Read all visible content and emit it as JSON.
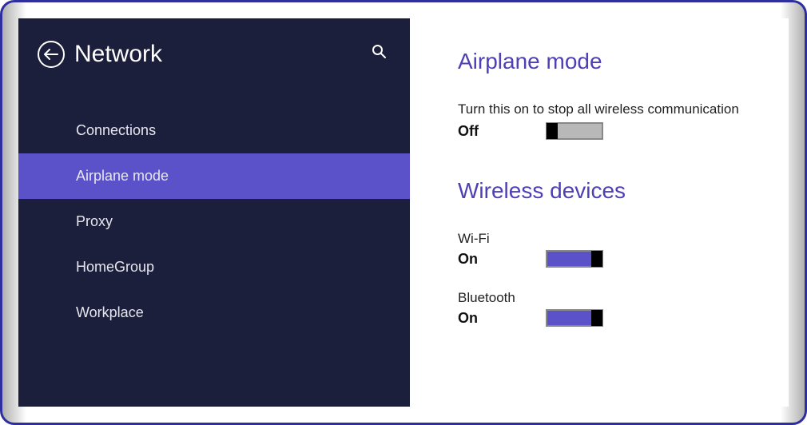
{
  "sidebar": {
    "title": "Network",
    "items": [
      {
        "label": "Connections",
        "selected": false
      },
      {
        "label": "Airplane mode",
        "selected": true
      },
      {
        "label": "Proxy",
        "selected": false
      },
      {
        "label": "HomeGroup",
        "selected": false
      },
      {
        "label": "Workplace",
        "selected": false
      }
    ]
  },
  "content": {
    "airplane": {
      "heading": "Airplane mode",
      "description": "Turn this on to stop all wireless communication",
      "state_label": "Off",
      "state": "off"
    },
    "wireless": {
      "heading": "Wireless devices",
      "devices": [
        {
          "name": "Wi-Fi",
          "state_label": "On",
          "state": "on"
        },
        {
          "name": "Bluetooth",
          "state_label": "On",
          "state": "on"
        }
      ]
    }
  }
}
